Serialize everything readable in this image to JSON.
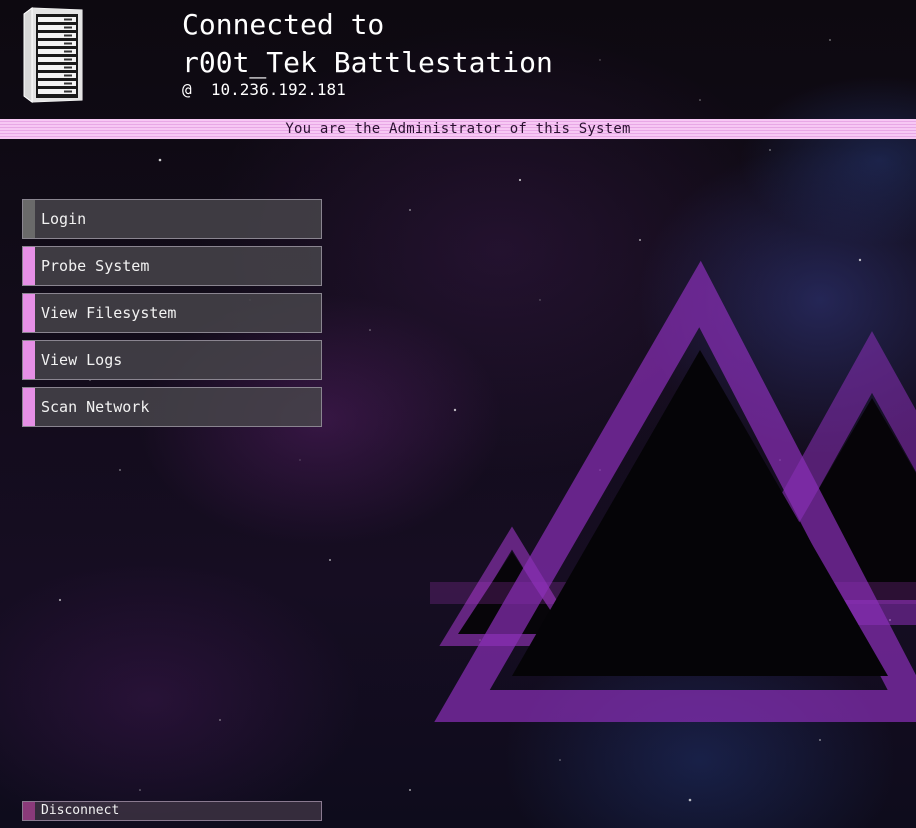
{
  "header": {
    "title_line1": "Connected to",
    "title_line2": "r00t_Tek Battlestation",
    "ip_line": "@  10.236.192.181",
    "server_icon": "server-rack-icon"
  },
  "banner": {
    "text": "You are the Administrator of this System"
  },
  "menu": {
    "items": [
      {
        "label": "Login"
      },
      {
        "label": "Probe System"
      },
      {
        "label": "View Filesystem"
      },
      {
        "label": "View Logs"
      },
      {
        "label": "Scan Network"
      }
    ]
  },
  "footer": {
    "disconnect_label": "Disconnect"
  },
  "colors": {
    "accent": "#e690e6",
    "banner_bg": "#f7c8f4",
    "button_bg": "#46444a",
    "triangle_outline": "#8a2fb8"
  }
}
